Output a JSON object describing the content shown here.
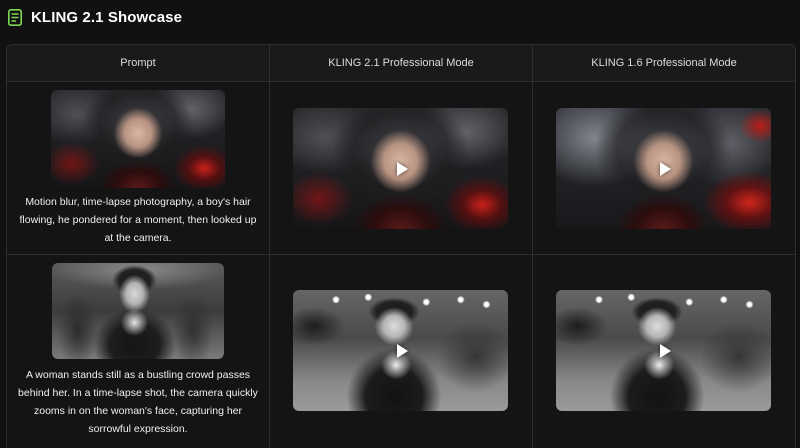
{
  "header": {
    "title": "KLING 2.1 Showcase",
    "icon": "document-icon",
    "icon_color": "#7ed957"
  },
  "table": {
    "columns": [
      "Prompt",
      "KLING 2.1 Professional Mode",
      "KLING 1.6 Professional Mode"
    ],
    "rows": [
      {
        "prompt": "Motion blur, time-lapse photography, a boy's hair flowing, he pondered for a moment, then looked up at the camera.",
        "prompt_image": "boy-hair-flowing-image",
        "kling21_video": "boy-hair-flowing-video",
        "kling16_video": "boy-hair-flowing-video"
      },
      {
        "prompt": "A woman stands still as a bustling crowd passes behind her. In a time-lapse shot, the camera quickly zooms in on the woman's face, capturing her sorrowful expression.",
        "prompt_image": "woman-crowd-image",
        "kling21_video": "woman-crowd-video",
        "kling16_video": "woman-crowd-video"
      }
    ]
  },
  "colors": {
    "background": "#111111",
    "border": "#2e2e2e",
    "text": "#f0f0f0"
  }
}
